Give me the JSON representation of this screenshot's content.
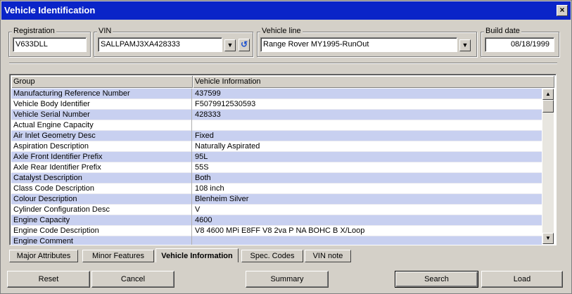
{
  "window": {
    "title": "Vehicle Identification",
    "close_label": "×"
  },
  "registration": {
    "label": "Registration",
    "value": "V633DLL"
  },
  "vin": {
    "label": "VIN",
    "value": "SALLPAMJ3XA428333",
    "refresh_icon": "↺"
  },
  "vehicle_line": {
    "label": "Vehicle line",
    "value": "Range Rover MY1995-RunOut"
  },
  "build_date": {
    "label": "Build date",
    "value": "08/18/1999"
  },
  "table": {
    "columns": [
      "Group",
      "Vehicle Information"
    ],
    "rows": [
      [
        "Manufacturing Reference Number",
        "437599"
      ],
      [
        "Vehicle Body Identifier",
        "F5079912530593"
      ],
      [
        "Vehicle Serial Number",
        "428333"
      ],
      [
        "Actual Engine Capacity",
        ""
      ],
      [
        "Air Inlet Geometry Desc",
        "Fixed"
      ],
      [
        "Aspiration Description",
        "Naturally Aspirated"
      ],
      [
        "Axle Front Identifier Prefix",
        "95L"
      ],
      [
        "Axle Rear Identifier Prefix",
        "55S"
      ],
      [
        "Catalyst Description",
        "Both"
      ],
      [
        "Class Code Description",
        "108 inch"
      ],
      [
        "Colour Description",
        "Blenheim Silver"
      ],
      [
        "Cylinder Configuration Desc",
        "V"
      ],
      [
        "Engine Capacity",
        "4600"
      ],
      [
        "Engine Code Description",
        "V8 4600 MPi  E8FF V8 2va P NA BOHC B X/Loop"
      ],
      [
        "Engine Comment",
        ""
      ]
    ]
  },
  "tabs": [
    {
      "label": "Major Attributes",
      "active": false
    },
    {
      "label": "Minor Features",
      "active": false
    },
    {
      "label": "Vehicle Information",
      "active": true
    },
    {
      "label": "Spec. Codes",
      "active": false
    },
    {
      "label": "VIN note",
      "active": false
    }
  ],
  "buttons": {
    "reset": "Reset",
    "cancel": "Cancel",
    "summary": "Summary",
    "search": "Search",
    "load": "Load"
  },
  "colors": {
    "titlebar": "#0a24c8",
    "row_highlight": "#c8d0f0",
    "face": "#d4d0c8"
  }
}
